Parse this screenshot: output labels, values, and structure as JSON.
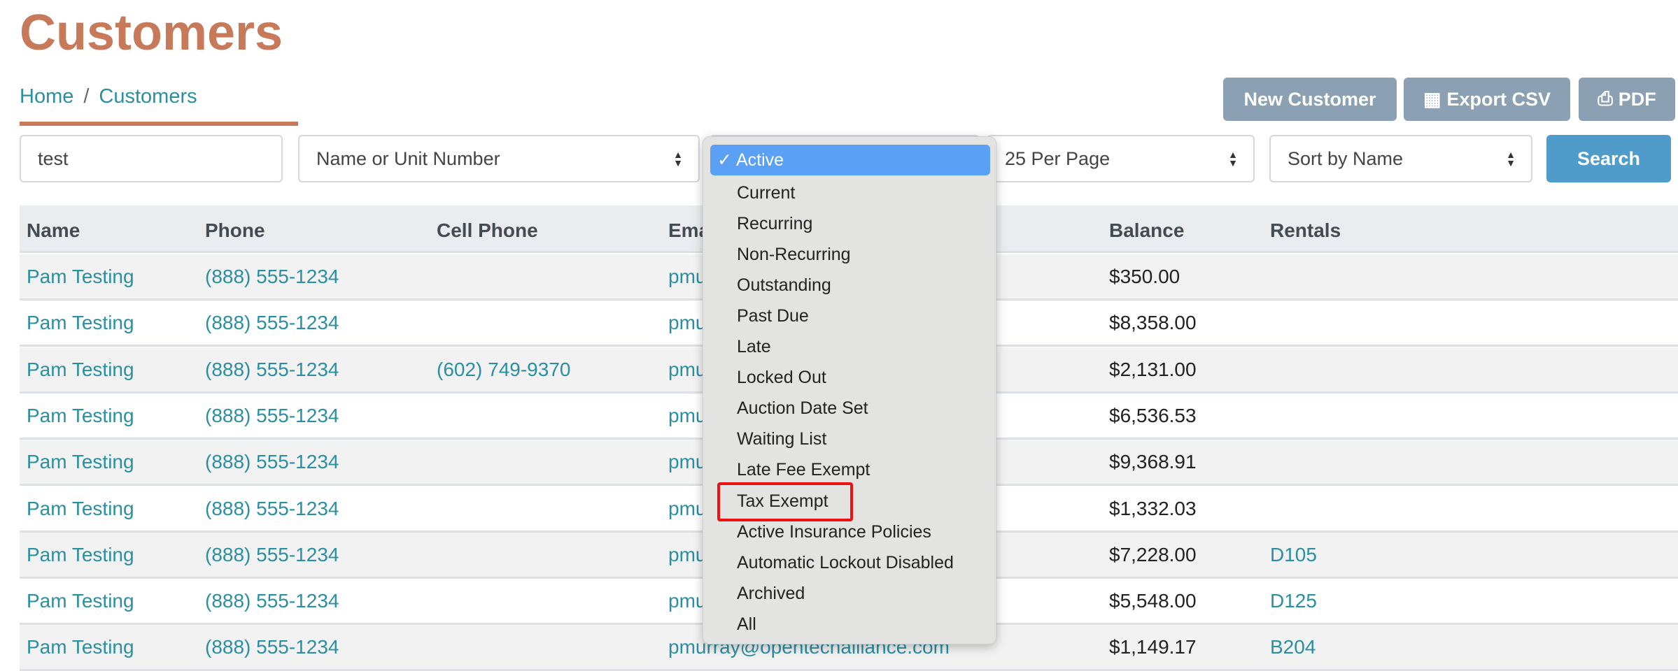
{
  "title": "Customers",
  "breadcrumb": {
    "home": "Home",
    "separator": "/",
    "current": "Customers"
  },
  "actions": {
    "new_customer": "New Customer",
    "export_csv": "Export CSV",
    "pdf": "PDF"
  },
  "filters": {
    "search_value": "test",
    "search_by": "Name or Unit Number",
    "status": "Active",
    "per_page": "25 Per Page",
    "sort": "Sort by Name",
    "search_button": "Search"
  },
  "status_options": [
    "Active",
    "Current",
    "Recurring",
    "Non-Recurring",
    "Outstanding",
    "Past Due",
    "Late",
    "Locked Out",
    "Auction Date Set",
    "Waiting List",
    "Late Fee Exempt",
    "Tax Exempt",
    "Active Insurance Policies",
    "Automatic Lockout Disabled",
    "Archived",
    "All"
  ],
  "highlighted_option": "Tax Exempt",
  "colors": {
    "title": "#c77a5a",
    "link": "#2a8fa0",
    "action_button": "#8ba1b3",
    "search_button": "#4f9bc9",
    "highlight": "#5aa0f5",
    "annotation": "#ee1111"
  },
  "table": {
    "columns": [
      "Name",
      "Phone",
      "Cell Phone",
      "Email",
      "Balance",
      "Rentals"
    ],
    "rows": [
      {
        "name": "Pam Testing",
        "phone": "(888) 555-1234",
        "cell": "",
        "email": "pmu",
        "balance": "$350.00",
        "rentals": ""
      },
      {
        "name": "Pam Testing",
        "phone": "(888) 555-1234",
        "cell": "",
        "email": "pmu",
        "balance": "$8,358.00",
        "rentals": ""
      },
      {
        "name": "Pam Testing",
        "phone": "(888) 555-1234",
        "cell": "(602) 749-9370",
        "email": "pmu",
        "balance": "$2,131.00",
        "rentals": ""
      },
      {
        "name": "Pam Testing",
        "phone": "(888) 555-1234",
        "cell": "",
        "email": "pmu",
        "balance": "$6,536.53",
        "rentals": ""
      },
      {
        "name": "Pam Testing",
        "phone": "(888) 555-1234",
        "cell": "",
        "email": "pmu",
        "balance": "$9,368.91",
        "rentals": ""
      },
      {
        "name": "Pam Testing",
        "phone": "(888) 555-1234",
        "cell": "",
        "email": "pmu",
        "balance": "$1,332.03",
        "rentals": ""
      },
      {
        "name": "Pam Testing",
        "phone": "(888) 555-1234",
        "cell": "",
        "email": "pmu",
        "balance": "$7,228.00",
        "rentals": "D105"
      },
      {
        "name": "Pam Testing",
        "phone": "(888) 555-1234",
        "cell": "",
        "email": "pmu",
        "balance": "$5,548.00",
        "rentals": "D125"
      },
      {
        "name": "Pam Testing",
        "phone": "(888) 555-1234",
        "cell": "",
        "email": "pmurray@opentechalliance.com",
        "balance": "$1,149.17",
        "rentals": "B204"
      }
    ]
  }
}
